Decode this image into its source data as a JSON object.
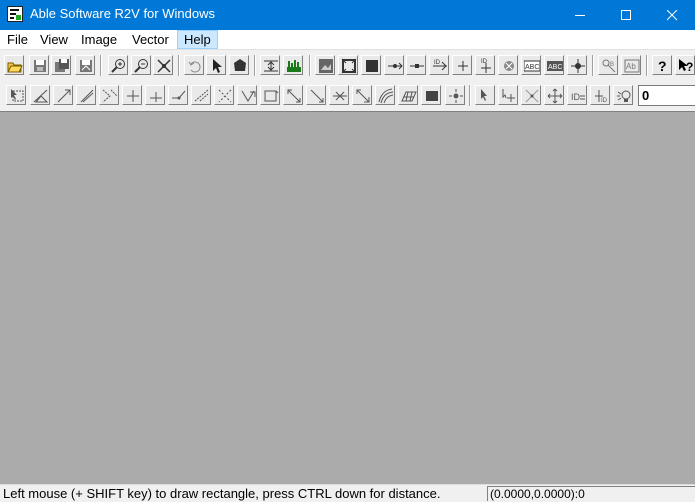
{
  "window": {
    "title": "Able Software R2V for Windows",
    "accent_color": "#0078d7",
    "workspace_color": "#ababab"
  },
  "menu": [
    "File",
    "View",
    "Image",
    "Vector",
    "Help"
  ],
  "menu_active": "Help",
  "toolbar1": {
    "buttons": [
      "open-icon",
      "save-icon",
      "save-all-icon",
      "save-vector-icon",
      "zoom-in-icon",
      "zoom-out-icon",
      "zoom-extent-icon",
      "undo-icon",
      "select-arrow-icon",
      "polygon-fill-icon",
      "fit-width-icon",
      "histogram-icon",
      "image-edit-icon",
      "image-crop-icon",
      "image-frame-icon",
      "node-add-icon",
      "node-link-icon",
      "point-move-icon",
      "point-icon",
      "point-label-icon",
      "point-delete-icon",
      "text-label-icon",
      "text-abc-icon",
      "crosshair-icon",
      "layer-icon",
      "ocr-icon",
      "help-icon",
      "context-help-icon"
    ]
  },
  "toolbar2": {
    "buttons": [
      "select-tool-icon",
      "line-draw-icon",
      "arrow-line-icon",
      "freehand-icon",
      "segment-icon",
      "node-up-icon",
      "node-down-icon",
      "join-line-icon",
      "split-line-icon",
      "trace-icon",
      "close-polygon-icon",
      "rectangle-icon",
      "line-diagonal-icon",
      "line-reverse-icon",
      "line-cross-icon",
      "contour-icon",
      "contour-bundle-icon",
      "grid-icon",
      "fill-block-icon",
      "point-light-icon",
      "pointer-add-icon",
      "node-plus-icon",
      "node-remove-icon",
      "move-node-icon",
      "id-tag-icon",
      "id-point-icon",
      "bulb-icon"
    ],
    "value_field": "0"
  },
  "status": {
    "message": "Left mouse (+ SHIFT key) to draw rectangle, press CTRL down for distance.",
    "coordinates": "(0.0000,0.0000):0"
  }
}
